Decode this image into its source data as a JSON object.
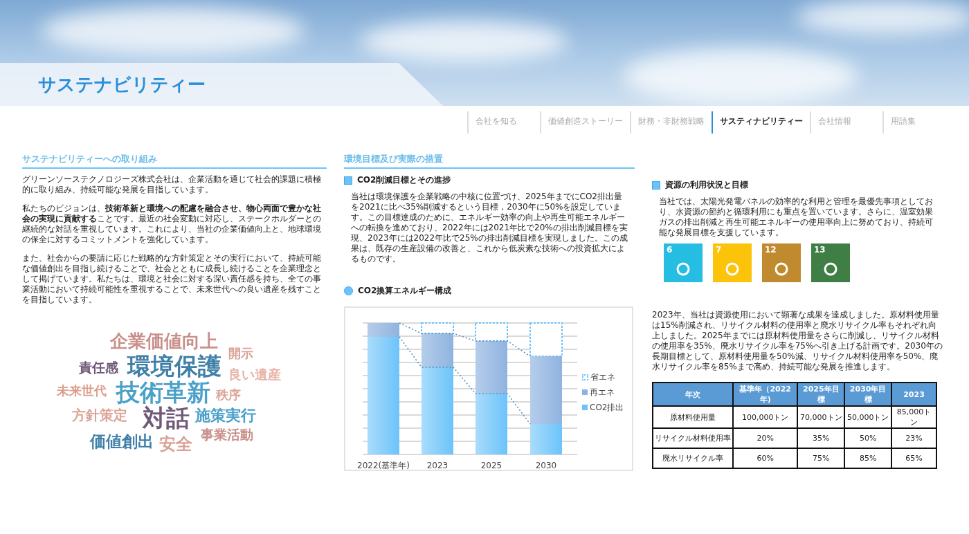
{
  "header": {
    "title": "サステナビリティー"
  },
  "nav": [
    {
      "label": "会社を知る",
      "selected": false
    },
    {
      "label": "価値創造ストーリー",
      "selected": false
    },
    {
      "label": "財務・非財務戦略",
      "selected": false
    },
    {
      "label": "サスティナビリティー",
      "selected": true
    },
    {
      "label": "会社情報",
      "selected": false
    },
    {
      "label": "用語集",
      "selected": false
    }
  ],
  "left": {
    "heading": "サステナビリティーへの取り組み",
    "paragraphs": [
      "グリーンソーステクノロジーズ株式会社は、企業活動を通じて社会的課題に積極的に取り組み、持続可能な発展を目指しています。",
      "私たちのビジョンは、**技術革新と環境への配慮を融合させ、物心両面で豊かな社会の実現に貢献する**ことです。最近の社会変動に対応し、ステークホルダーとの継続的な対話を重視しています。これにより、当社の企業価値向上と、地球環境の保全に対するコミットメントを強化しています。",
      "また、社会からの要請に応じた戦略的な方針策定とその実行において、持続可能な価値創出を目指し続けることで、社会とともに成長し続けることを企業理念として掲げています。私たちは、環境と社会に対する深い責任感を持ち、全ての事業活動において持続可能性を重視することで、未来世代への良い遺産を残すことを目指しています。"
    ],
    "word_cloud": [
      {
        "text": "企業価値向上",
        "color": "#c98f8a"
      },
      {
        "text": "開示",
        "color": "#d9a196"
      },
      {
        "text": "責任感",
        "color": "#6f5878"
      },
      {
        "text": "環境保護",
        "color": "#3f7fa8"
      },
      {
        "text": "良い遺産",
        "color": "#e8b4a8"
      },
      {
        "text": "未来世代",
        "color": "#dc9f8e"
      },
      {
        "text": "技術革新",
        "color": "#4aa0c8"
      },
      {
        "text": "秩序",
        "color": "#dba59a"
      },
      {
        "text": "方針策定",
        "color": "#dca496"
      },
      {
        "text": "対話",
        "color": "#6f5878"
      },
      {
        "text": "施策実行",
        "color": "#4aa0c8"
      },
      {
        "text": "事業活動",
        "color": "#c98f8a"
      },
      {
        "text": "価値創出",
        "color": "#3f7fa8"
      },
      {
        "text": "安全",
        "color": "#d9a196"
      }
    ]
  },
  "middle": {
    "heading": "環境目標及び実際の措置",
    "section": {
      "title": "CO2削減目標とその進捗",
      "body": "当社は環境保護を企業戦略の中核に位置づけ、2025年までにCO2排出量を2021に比べ35%削減するという目標，2030年に50%を設定しています。この目標達成のために、エネルギー効率の向上や再生可能エネルギーへの転換を進めており、2022年には2021年比で20%の排出削減目標を実現、2023年には2022年比で25%の排出削減目標を実現しました。この成果は、既存の生産設備の改善と、これから低炭素な技術への投資拡大によるものです。"
    },
    "chart": {
      "title": "CO2換算エネルギー構成",
      "categories": [
        "2022(基準年)",
        "2023",
        "2025",
        "2030"
      ],
      "legend": [
        "省エネ",
        "再エネ",
        "CO2排出"
      ]
    }
  },
  "right": {
    "section": {
      "title": "資源の利用状況と目標",
      "body": "当社では、太陽光発電パネルの効率的な利用と管理を最優先事項としており、水資源の節約と循環利用にも重点を置いています。さらに、温室効果ガスの排出削減と再生可能エネルギーの使用率向上に努めており、持続可能な発展目標を支援しています。"
    },
    "sdg_icons": [
      {
        "number": "6",
        "color": "#26bde2"
      },
      {
        "number": "7",
        "color": "#fcc30b"
      },
      {
        "number": "12",
        "color": "#bf8b2e"
      },
      {
        "number": "13",
        "color": "#3f7e44"
      }
    ],
    "summary": "2023年、当社は資源使用において顕著な成果を達成しました。原材料使用量は15%削減され、リサイクル材料の使用率と廃水リサイクル率もそれぞれ向上しました。2025年までには原材料使用量をさらに削減し、リサイクル材料の使用率を35%、廃水リサイクル率を75%へ引き上げる計画です。2030年の長期目標として、原材料使用量を50%減、リサイクル材料使用率を50%、廃水リサイクル率を85%まで高め、持続可能な発展を推進します。",
    "table": {
      "columns": [
        "年次",
        "基準年（2022年)",
        "2025年目標",
        "2030年目標",
        "2023"
      ],
      "rows": [
        [
          "原材料使用量",
          "100,000トン",
          "70,000トン",
          "50,000トン",
          "85,000トン"
        ],
        [
          "リサイクル材料使用率",
          "20%",
          "35%",
          "50%",
          "23%"
        ],
        [
          "廃水リサイクル率",
          "60%",
          "75%",
          "85%",
          "65%"
        ]
      ]
    }
  }
}
